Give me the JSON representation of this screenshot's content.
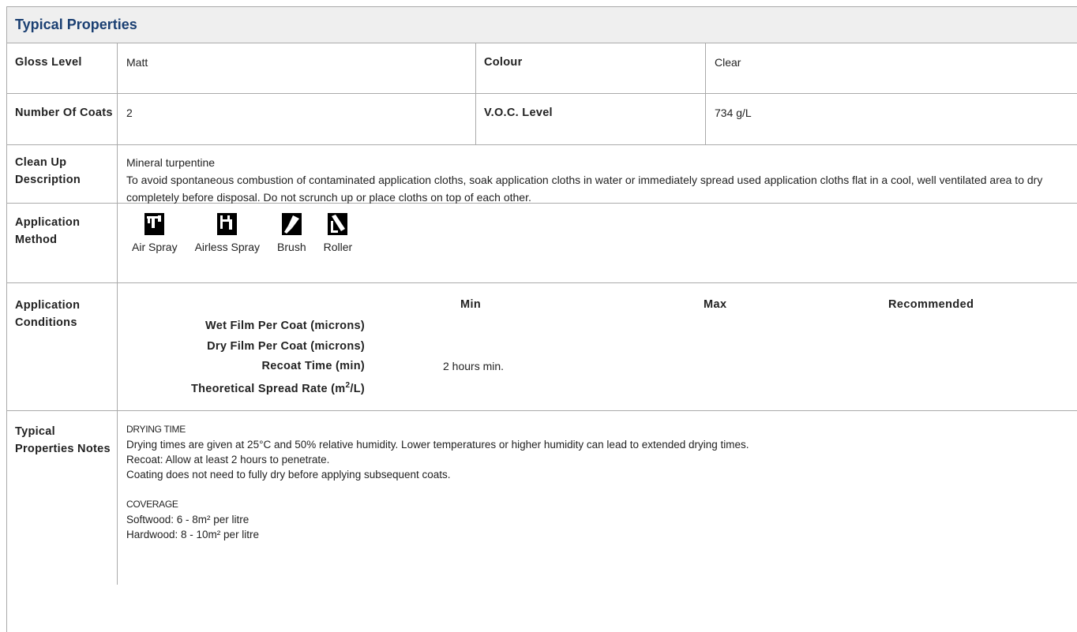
{
  "section": {
    "title": "Typical Properties"
  },
  "rows": {
    "gloss": {
      "label": "Gloss Level",
      "value": "Matt",
      "label2": "Colour",
      "value2": "Clear"
    },
    "coats": {
      "label": "Number Of Coats",
      "value": "2",
      "label2": "V.O.C. Level",
      "value2": "734 g/L"
    },
    "cleanup": {
      "label": "Clean Up Description",
      "line1": "Mineral turpentine",
      "line2": "To avoid spontaneous combustion of contaminated application cloths, soak application cloths in water or immediately spread used application cloths flat in a cool, well ventilated area to dry completely before disposal. Do not scrunch up or place cloths on top of each other."
    },
    "method": {
      "label": "Application Method",
      "items": [
        {
          "name": "Air Spray",
          "icon": "air-spray-icon"
        },
        {
          "name": "Airless Spray",
          "icon": "airless-spray-icon"
        },
        {
          "name": "Brush",
          "icon": "brush-icon"
        },
        {
          "name": "Roller",
          "icon": "roller-icon"
        }
      ]
    },
    "conditions": {
      "label": "Application Conditions",
      "headers": {
        "min": "Min",
        "max": "Max",
        "recommended": "Recommended"
      },
      "wet_film": "Wet Film Per Coat (microns)",
      "dry_film": "Dry Film Per Coat (microns)",
      "recoat": "Recoat Time (min)",
      "recoat_min": "2 hours min.",
      "spread_prefix": "Theoretical Spread Rate (m",
      "spread_sup": "2",
      "spread_suffix": "/L)"
    },
    "notes": {
      "label": "Typical Properties Notes",
      "drying_heading": "DRYING TIME",
      "drying_1": "Drying times are given at 25°C and 50% relative humidity. Lower temperatures or higher humidity can lead to extended drying times.",
      "drying_2": "Recoat: Allow at least 2 hours to penetrate.",
      "drying_3": "Coating does not need to fully dry before applying subsequent coats.",
      "coverage_heading": "COVERAGE",
      "coverage_1": "Softwood: 6 - 8m² per litre",
      "coverage_2": "Hardwood: 8 - 10m² per litre"
    }
  }
}
